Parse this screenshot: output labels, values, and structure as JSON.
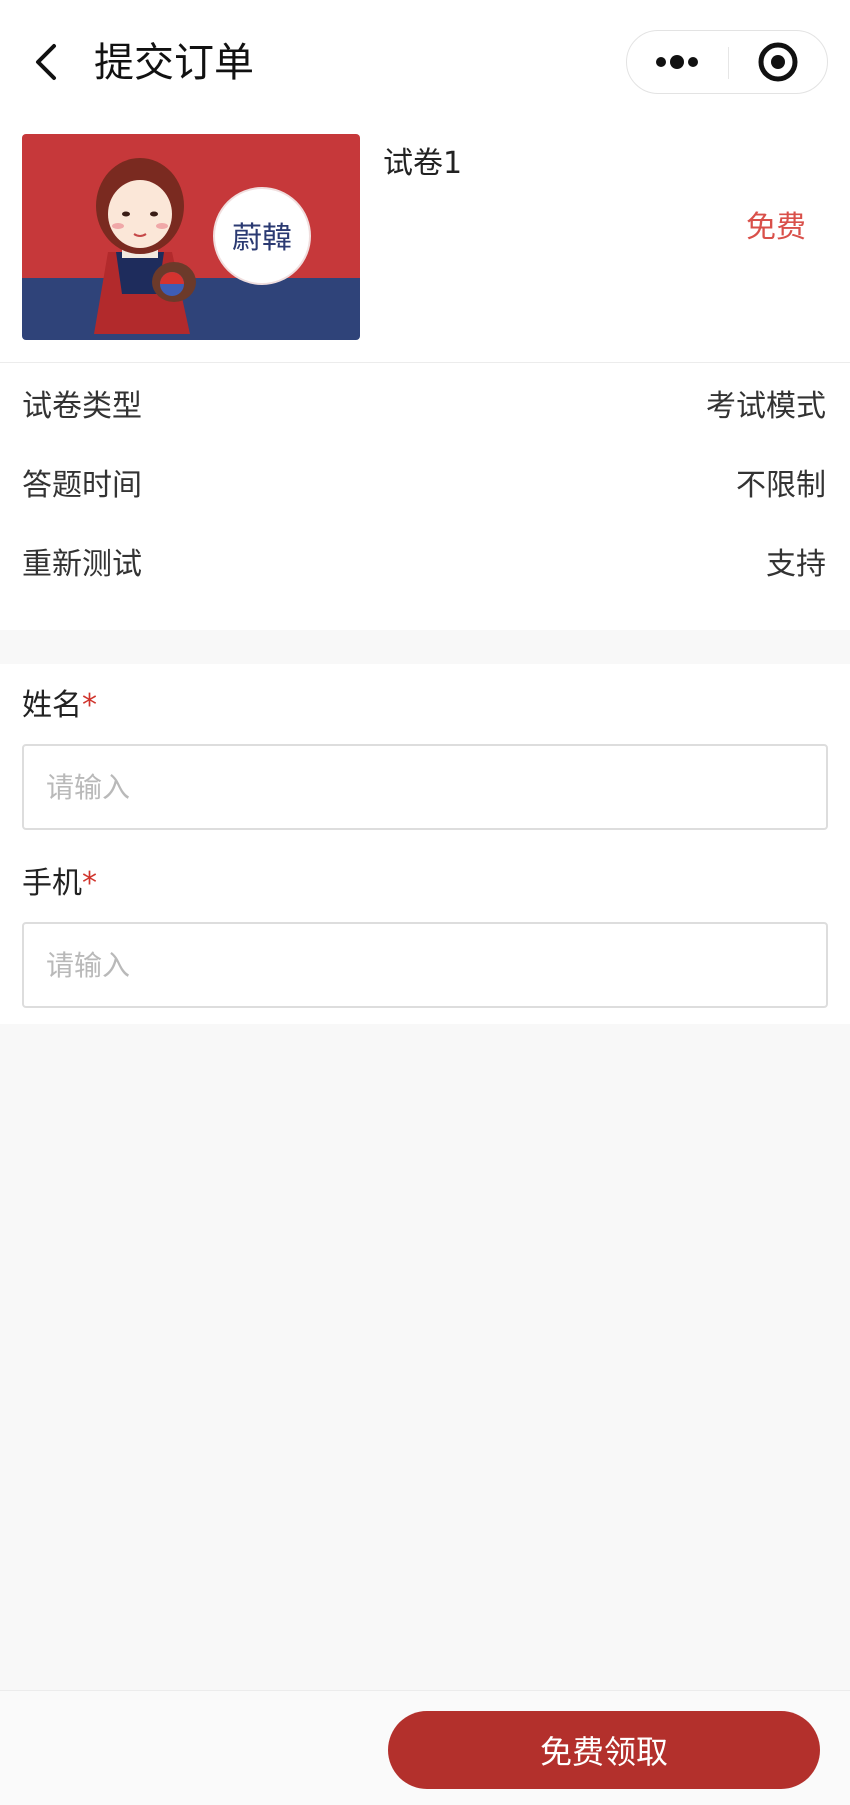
{
  "header": {
    "title": "提交订单"
  },
  "product": {
    "name": "试卷1",
    "price": "免费",
    "logo_text": "蔚韓"
  },
  "info": [
    {
      "label": "试卷类型",
      "value": "考试模式"
    },
    {
      "label": "答题时间",
      "value": "不限制"
    },
    {
      "label": "重新测试",
      "value": "支持"
    }
  ],
  "form": {
    "name_label": "姓名",
    "name_placeholder": "请输入",
    "phone_label": "手机",
    "phone_placeholder": "请输入",
    "required_mark": "*"
  },
  "footer": {
    "cta_label": "免费领取"
  },
  "colors": {
    "accent": "#b3302c",
    "price": "#d9504a",
    "required": "#d0342c"
  }
}
